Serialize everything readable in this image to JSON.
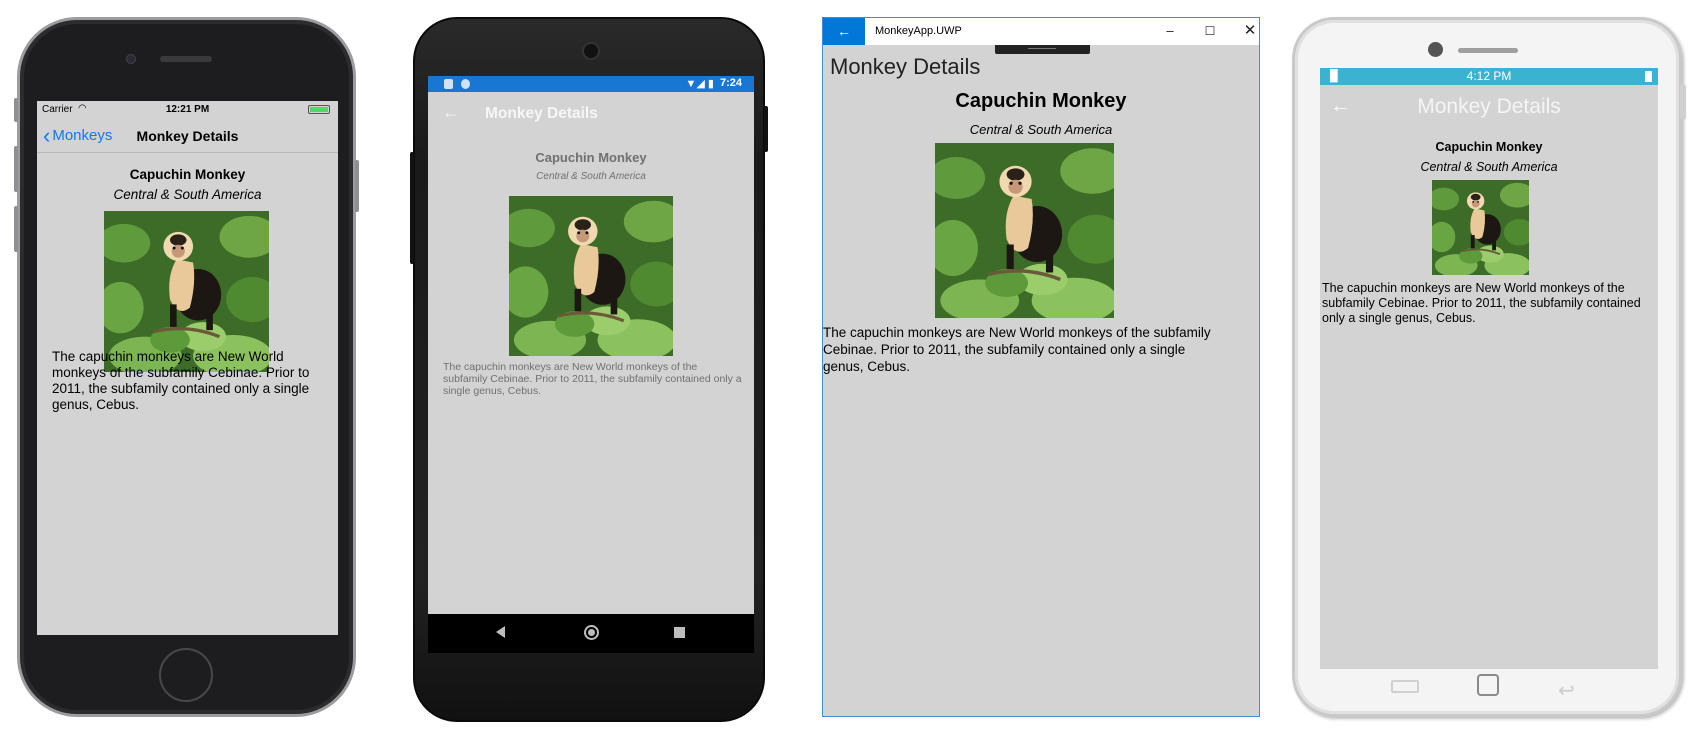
{
  "colors": {
    "page_bg": "#d3d3d3",
    "ios_link": "#0a7aff",
    "android_status": "#1976d2",
    "uwp_accent": "#0078d7",
    "tizen_status": "#3bb2d0"
  },
  "ios": {
    "status": {
      "carrier": "Carrier",
      "time": "12:21 PM"
    },
    "nav": {
      "back_label": "Monkeys",
      "title": "Monkey Details"
    },
    "monkey": {
      "name": "Capuchin Monkey",
      "location": "Central & South America",
      "details": "The capuchin monkeys are New World monkeys of the subfamily Cebinae. Prior to 2011, the subfamily contained only a single genus, Cebus."
    }
  },
  "android": {
    "status": {
      "time": "7:24"
    },
    "appbar": {
      "title": "Monkey Details"
    },
    "monkey": {
      "name": "Capuchin Monkey",
      "location": "Central & South America",
      "details": "The capuchin monkeys are New World monkeys of the subfamily Cebinae. Prior to 2011, the subfamily contained only a single genus, Cebus."
    }
  },
  "uwp": {
    "window_title": "MonkeyApp.UWP",
    "page_title": "Monkey Details",
    "monkey": {
      "name": "Capuchin Monkey",
      "location": "Central & South America",
      "details": "The capuchin monkeys are New World monkeys of the subfamily Cebinae. Prior to 2011, the subfamily contained only a single genus, Cebus."
    }
  },
  "tizen": {
    "status": {
      "time": "4:12 PM"
    },
    "appbar": {
      "title": "Monkey Details"
    },
    "monkey": {
      "name": "Capuchin Monkey",
      "location": "Central & South America",
      "details": "The capuchin monkeys are New World monkeys of the subfamily Cebinae. Prior to 2011, the subfamily contained only a single genus, Cebus."
    }
  },
  "icons": {
    "ios_back": "chevron-left-icon",
    "android_back": "arrow-left-icon",
    "uwp_back": "arrow-left-icon",
    "tizen_back": "arrow-left-icon"
  }
}
